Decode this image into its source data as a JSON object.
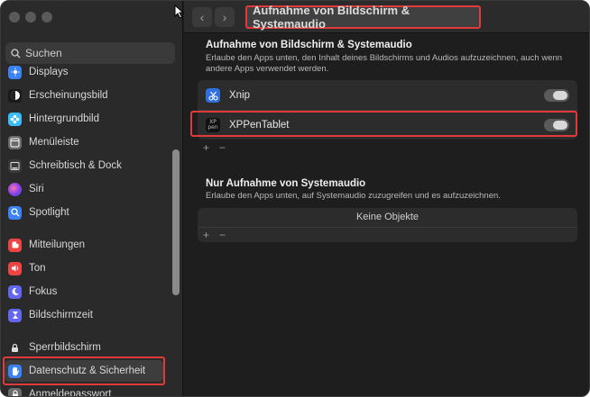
{
  "sidebar": {
    "search_placeholder": "Suchen",
    "items": [
      {
        "label": "Displays",
        "icon": "sun-icon",
        "color": "#3b82f6"
      },
      {
        "label": "Erscheinungsbild",
        "icon": "appearance-icon",
        "color": "#1a1a1a"
      },
      {
        "label": "Hintergrundbild",
        "icon": "flower-icon",
        "color": "#38bdf8"
      },
      {
        "label": "Menüleiste",
        "icon": "menubar-icon",
        "color": "#6b6b6b"
      },
      {
        "label": "Schreibtisch & Dock",
        "icon": "dock-icon",
        "color": "#3a3a3a"
      },
      {
        "label": "Siri",
        "icon": "siri-icon",
        "color": "#9333ea"
      },
      {
        "label": "Spotlight",
        "icon": "magnifier-icon",
        "color": "#3b82f6"
      },
      {
        "label": "Mitteilungen",
        "icon": "bell-icon",
        "color": "#ef4444"
      },
      {
        "label": "Ton",
        "icon": "speaker-icon",
        "color": "#ef4444"
      },
      {
        "label": "Fokus",
        "icon": "moon-icon",
        "color": "#6366f1"
      },
      {
        "label": "Bildschirmzeit",
        "icon": "hourglass-icon",
        "color": "#6366f1"
      },
      {
        "label": "Sperrbildschirm",
        "icon": "lock-screen-icon",
        "color": "#2a2a2a"
      },
      {
        "label": "Datenschutz & Sicherheit",
        "icon": "hand-icon",
        "color": "#3b82f6"
      },
      {
        "label": "Anmeldepasswort",
        "icon": "password-lock-icon",
        "color": "#6b6b6b"
      }
    ]
  },
  "header": {
    "back": "‹",
    "forward": "›",
    "title": "Aufnahme von Bildschirm & Systemaudio"
  },
  "screen_audio": {
    "title": "Aufnahme von Bildschirm & Systemaudio",
    "description": "Erlaube den Apps unten, den Inhalt deines Bildschirms und Audios aufzuzeichnen, auch wenn andere Apps verwendet werden.",
    "apps": [
      {
        "name": "Xnip",
        "icon": "xnip-icon",
        "enabled": true
      },
      {
        "name": "XPPenTablet",
        "icon": "xppen-icon",
        "enabled": true
      }
    ],
    "add": "+",
    "remove": "−"
  },
  "system_audio": {
    "title": "Nur Aufnahme von Systemaudio",
    "description": "Erlaube den Apps unten, auf Systemaudio zuzugreifen und es aufzuzeichnen.",
    "empty": "Keine Objekte",
    "add": "+",
    "remove": "−"
  },
  "xppen_logo": {
    "line1": "XP",
    "line2": "pen"
  }
}
